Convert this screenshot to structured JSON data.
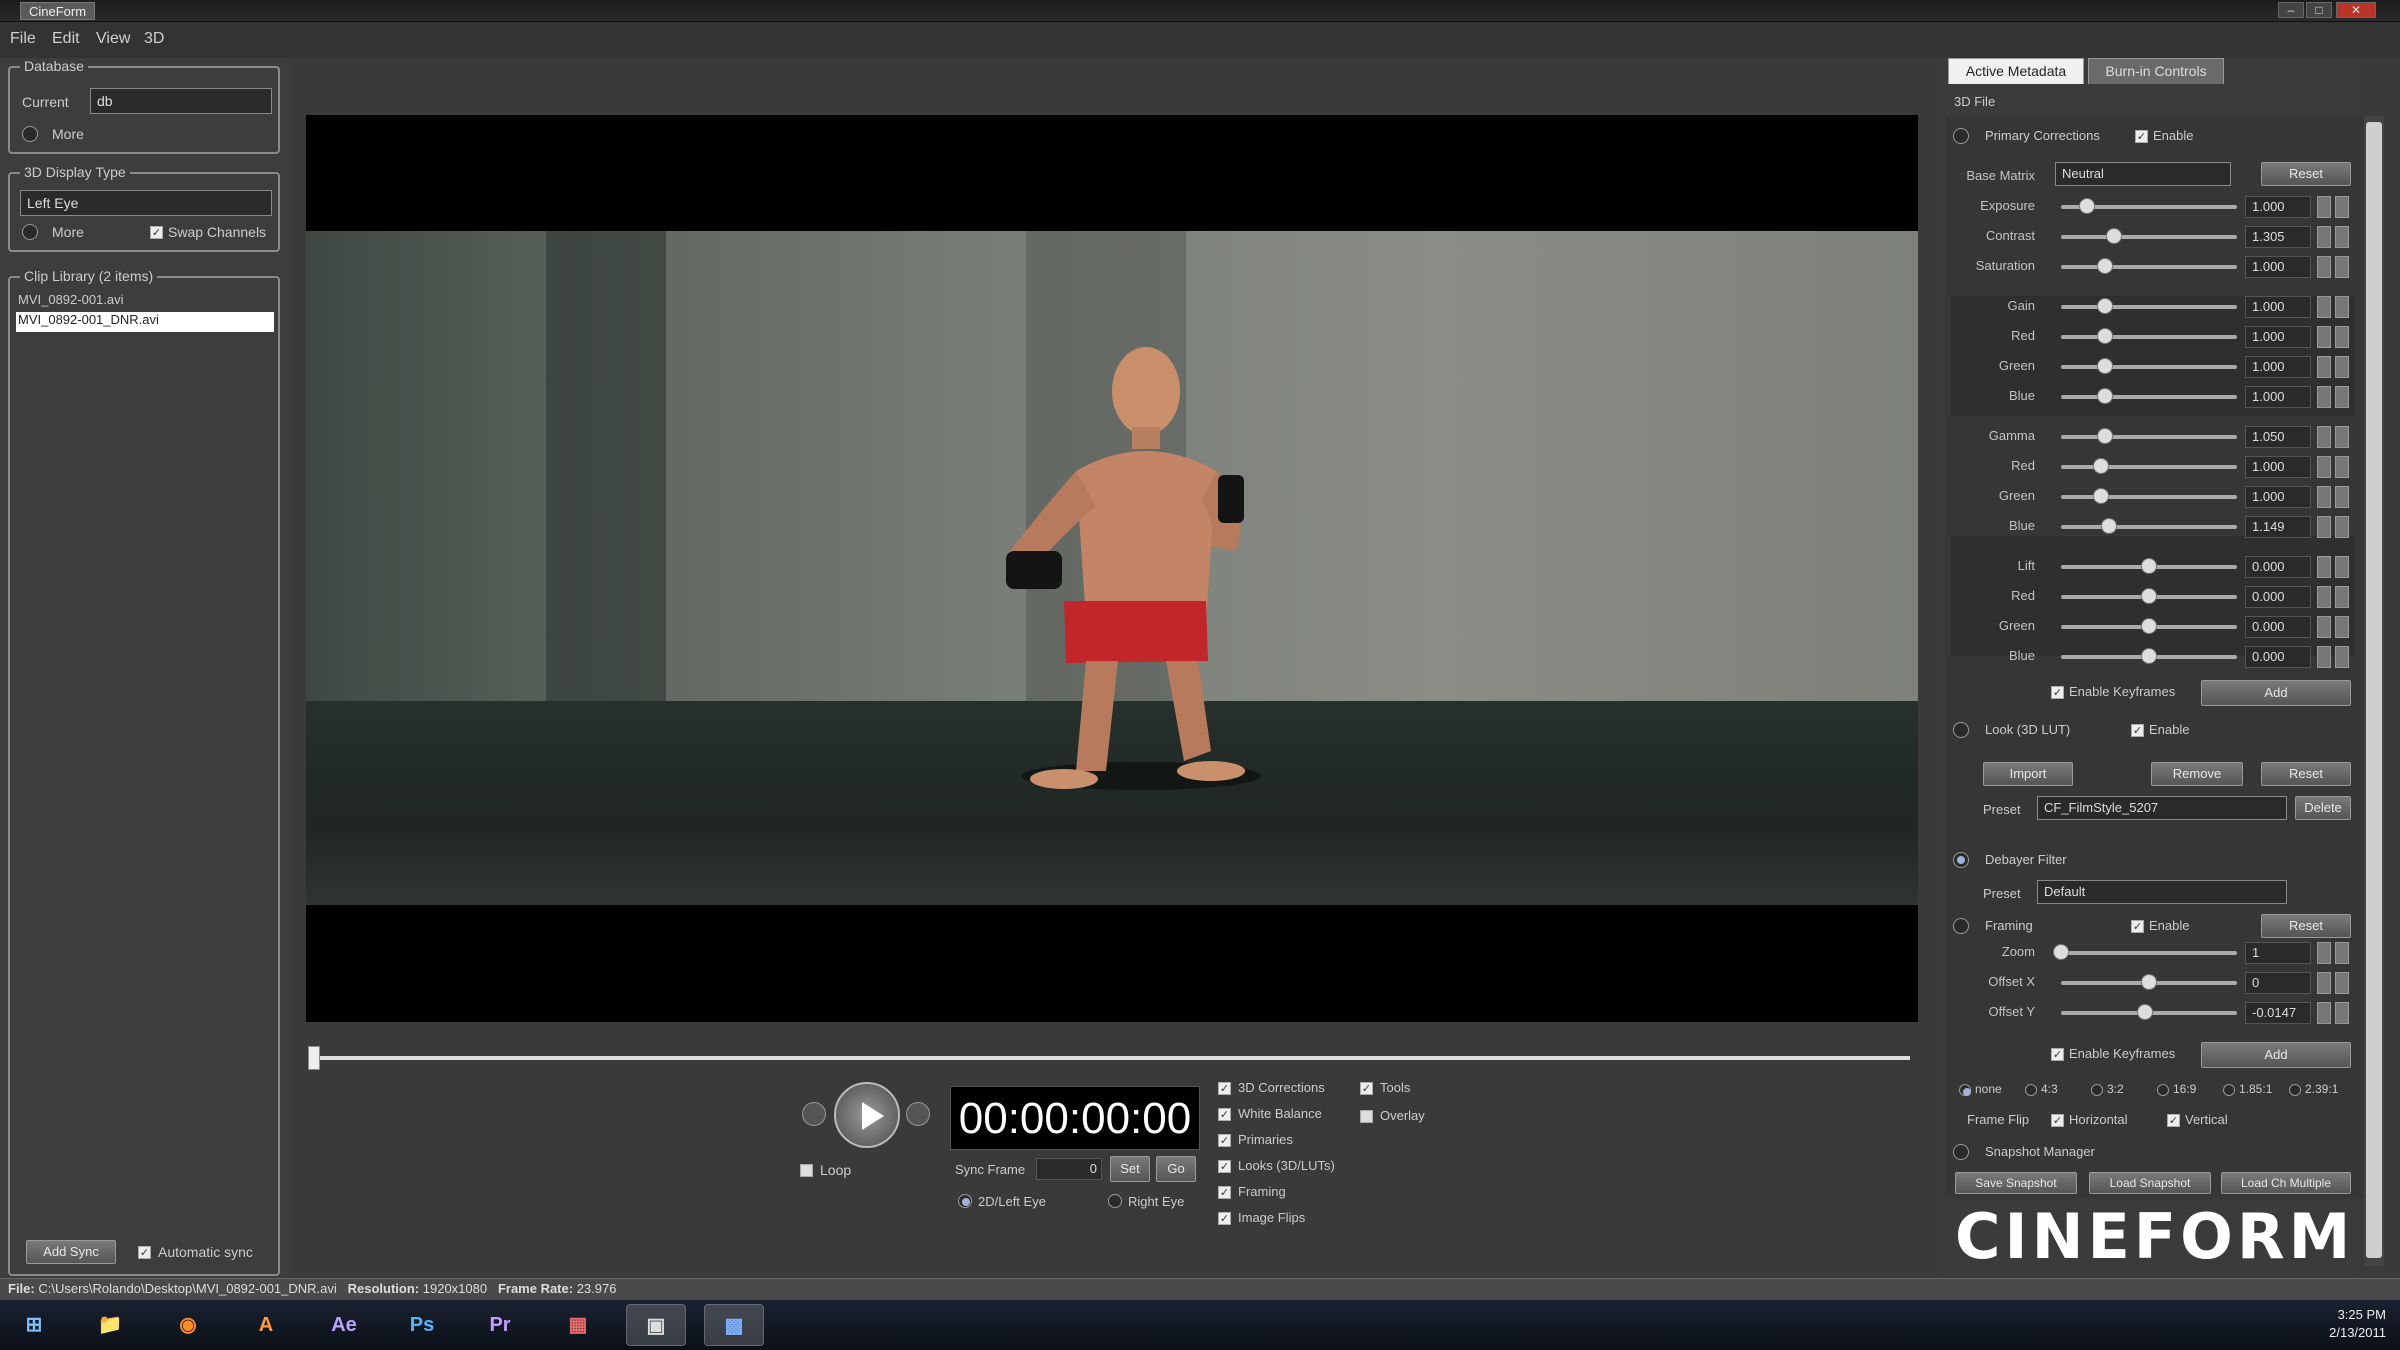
{
  "window": {
    "title": "CineForm",
    "controls": [
      "–",
      "□",
      "✕"
    ]
  },
  "menu": [
    "File",
    "Edit",
    "View",
    "3D"
  ],
  "left": {
    "database": {
      "label": "Database",
      "current_label": "Current",
      "current_value": "db",
      "more_label": "More"
    },
    "display": {
      "label": "3D Display Type",
      "value": "Left Eye",
      "more_label": "More",
      "swap_label": "Swap Channels"
    },
    "clips": {
      "label": "Clip Library (2 items)",
      "items": [
        "MVI_0892-001.avi",
        "MVI_0892-001_DNR.avi"
      ],
      "selected_index": 1
    },
    "add_sync": "Add Sync",
    "auto_sync": "Automatic sync"
  },
  "transport": {
    "timecode": "00:00:00:00",
    "loop": "Loop",
    "sync_frame_label": "Sync Frame",
    "sync_frame_value": "0",
    "set_btn": "Set",
    "go_btn": "Go",
    "eye_left": "2D/Left Eye",
    "eye_right": "Right Eye",
    "toggles_col1": [
      "3D Corrections",
      "White Balance",
      "Primaries",
      "Looks (3D/LUTs)",
      "Framing",
      "Image Flips"
    ],
    "toggles_col2": [
      "Tools",
      "Overlay"
    ]
  },
  "right": {
    "tabs": [
      "Active Metadata",
      "Burn-in Controls"
    ],
    "file_label": "3D File",
    "primary": {
      "title": "Primary Corrections",
      "enable": "Enable",
      "base_matrix_label": "Base Matrix",
      "base_matrix_value": "Neutral",
      "reset": "Reset",
      "rows": [
        {
          "label": "Exposure",
          "value": "1.000",
          "pos": 0.15
        },
        {
          "label": "Contrast",
          "value": "1.305",
          "pos": 0.3
        },
        {
          "label": "Saturation",
          "value": "1.000",
          "pos": 0.25
        },
        {
          "label": "Gain",
          "value": "1.000",
          "pos": 0.25
        },
        {
          "label": "Red",
          "value": "1.000",
          "pos": 0.25
        },
        {
          "label": "Green",
          "value": "1.000",
          "pos": 0.25
        },
        {
          "label": "Blue",
          "value": "1.000",
          "pos": 0.25
        },
        {
          "label": "Gamma",
          "value": "1.050",
          "pos": 0.25
        },
        {
          "label": "Red",
          "value": "1.000",
          "pos": 0.23
        },
        {
          "label": "Green",
          "value": "1.000",
          "pos": 0.23
        },
        {
          "label": "Blue",
          "value": "1.149",
          "pos": 0.27
        },
        {
          "label": "Lift",
          "value": "0.000",
          "pos": 0.5
        },
        {
          "label": "Red",
          "value": "0.000",
          "pos": 0.5
        },
        {
          "label": "Green",
          "value": "0.000",
          "pos": 0.5
        },
        {
          "label": "Blue",
          "value": "0.000",
          "pos": 0.5
        }
      ],
      "keyframes": "Enable Keyframes",
      "add": "Add"
    },
    "look": {
      "title": "Look (3D LUT)",
      "enable": "Enable",
      "import": "Import",
      "remove": "Remove",
      "reset": "Reset",
      "preset_label": "Preset",
      "preset_value": "CF_FilmStyle_5207",
      "delete": "Delete"
    },
    "debayer": {
      "title": "Debayer Filter",
      "preset_label": "Preset",
      "preset_value": "Default"
    },
    "framing": {
      "title": "Framing",
      "enable": "Enable",
      "reset": "Reset",
      "rows": [
        {
          "label": "Zoom",
          "value": "1",
          "pos": 0.0
        },
        {
          "label": "Offset X",
          "value": "0",
          "pos": 0.5
        },
        {
          "label": "Offset Y",
          "value": "-0.0147",
          "pos": 0.48
        }
      ],
      "keyframes": "Enable Keyframes",
      "add": "Add",
      "aspects": [
        "none",
        "4:3",
        "3:2",
        "16:9",
        "1.85:1",
        "2.39:1"
      ],
      "flip_label": "Frame Flip",
      "horizontal": "Horizontal",
      "vertical": "Vertical"
    },
    "snapshot": {
      "title": "Snapshot Manager",
      "save": "Save Snapshot",
      "load": "Load Snapshot",
      "load_multiple": "Load Ch Multiple"
    },
    "logo": "CINEFORM"
  },
  "status": {
    "file_label": "File:",
    "file_path": "C:\\Users\\Rolando\\Desktop\\MVI_0892-001_DNR.avi",
    "res_label": "Resolution:",
    "res_value": "1920x1080",
    "fps_label": "Frame Rate:",
    "fps_value": "23.976"
  },
  "taskbar": {
    "apps": [
      "⊞",
      "📁",
      "◉",
      "A",
      "Ae",
      "Ps",
      "Pr",
      "▦",
      "▣",
      "▩"
    ],
    "time": "3:25 PM",
    "date": "2/13/2011"
  }
}
